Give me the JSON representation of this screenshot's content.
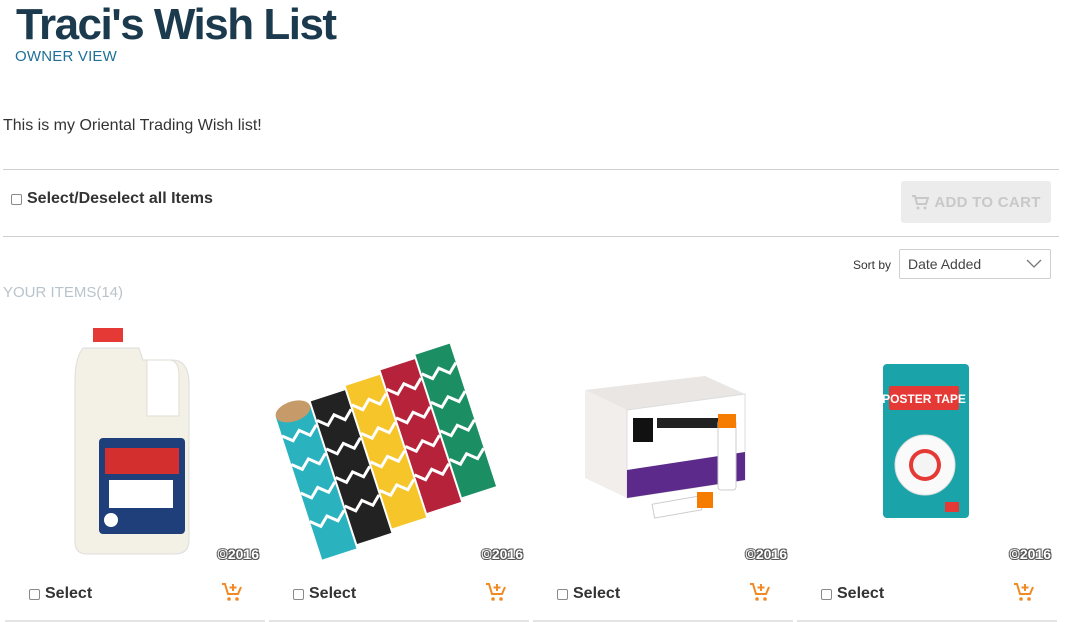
{
  "header": {
    "title": "Traci's Wish List",
    "view_label": "OWNER VIEW"
  },
  "description": "This is my Oriental Trading Wish list!",
  "toolbar": {
    "select_all_label": "Select/Deselect all Items",
    "add_to_cart_label": "ADD TO CART"
  },
  "sort": {
    "label": "Sort by",
    "selected": "Date Added"
  },
  "items_heading": "YOUR ITEMS(14)",
  "items": [
    {
      "image": "school-glue-gallon",
      "copyright": "©2016",
      "select_label": "Select"
    },
    {
      "image": "chevron-washi-tape",
      "copyright": "©2016",
      "select_label": "Select"
    },
    {
      "image": "glue-stick-box",
      "copyright": "©2016",
      "select_label": "Select"
    },
    {
      "image": "poster-tape",
      "copyright": "©2016",
      "select_label": "Select"
    }
  ],
  "poster_tape_text": "POSTER TAPE",
  "colors": {
    "title": "#1c3a4d",
    "link": "#1f6f97",
    "cart_orange": "#f08a24",
    "muted": "#b8c3cc"
  }
}
